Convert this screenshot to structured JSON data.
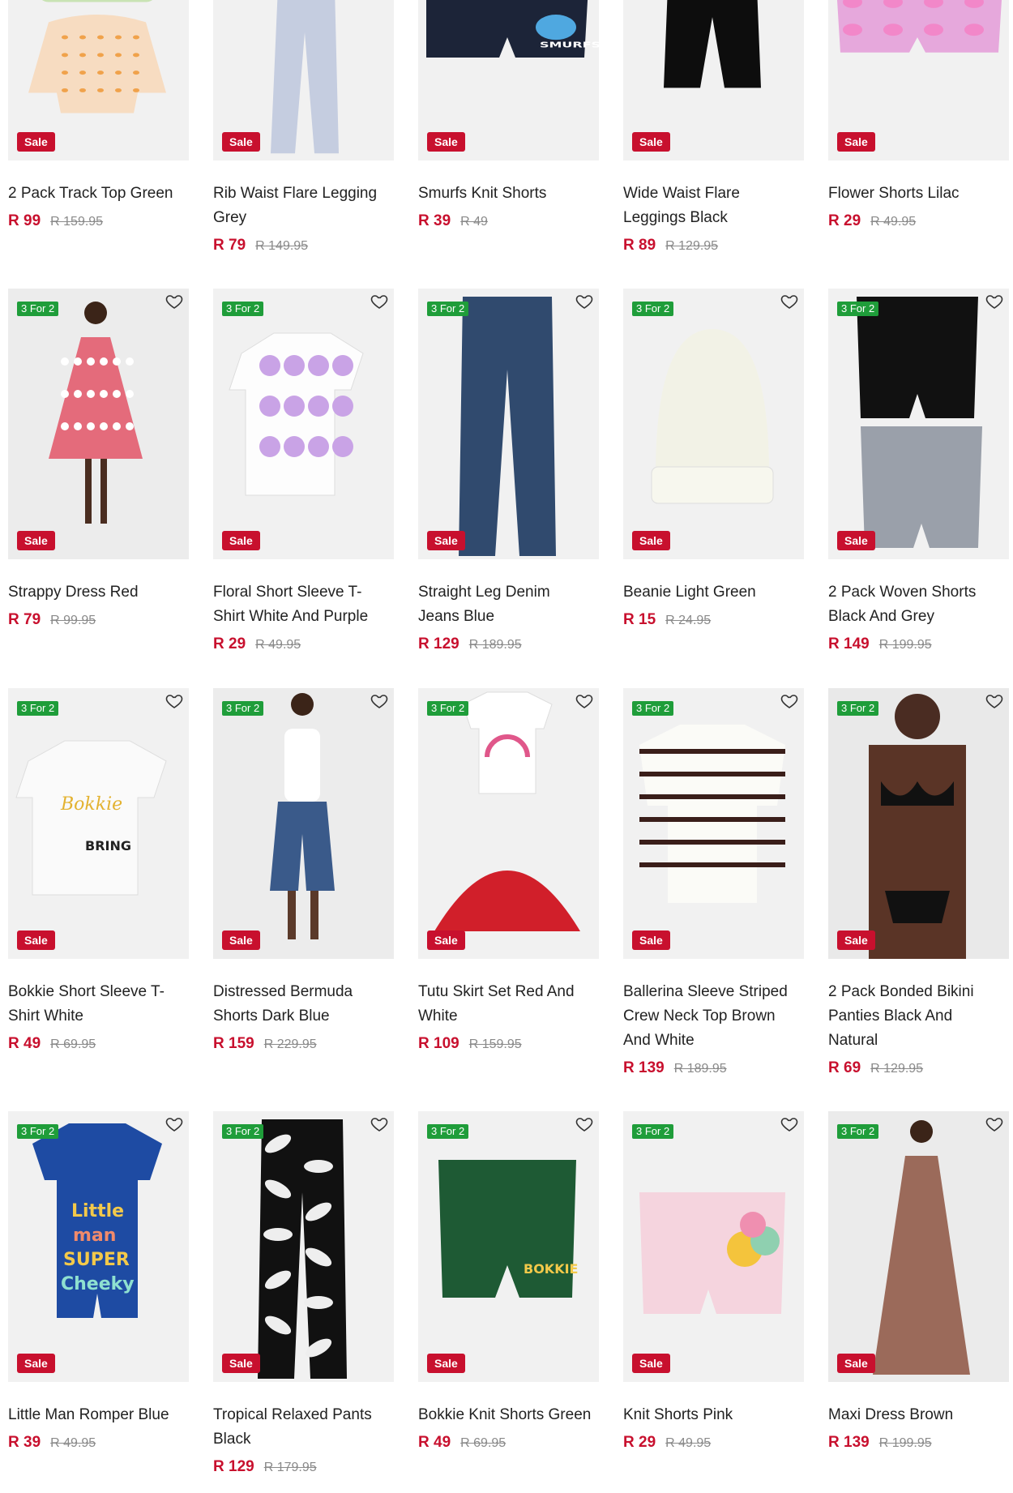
{
  "colors": {
    "sale": "#c8102e",
    "promo": "#1f9d3a",
    "price": "#c8102e",
    "was_price": "#8a8a8a"
  },
  "rows": [
    {
      "products": [
        {
          "name": "2 Pack Track Top Green",
          "price": "R 99",
          "was": "R 159.95",
          "sale_label": "Sale",
          "promo_label": "",
          "art": "hoodie"
        },
        {
          "name": "Rib Waist Flare Legging Grey",
          "price": "R 79",
          "was": "R 149.95",
          "sale_label": "Sale",
          "promo_label": "",
          "art": "legging-grey"
        },
        {
          "name": "Smurfs Knit Shorts",
          "price": "R 39",
          "was": "R 49",
          "sale_label": "Sale",
          "promo_label": "",
          "art": "shorts-navy"
        },
        {
          "name": "Wide Waist Flare Leggings Black",
          "price": "R 89",
          "was": "R 129.95",
          "sale_label": "Sale",
          "promo_label": "",
          "art": "legging-black"
        },
        {
          "name": "Flower Shorts Lilac",
          "price": "R 29",
          "was": "R 49.95",
          "sale_label": "Sale",
          "promo_label": "",
          "art": "shorts-lilac"
        }
      ]
    },
    {
      "products": [
        {
          "name": "Strappy Dress Red",
          "price": "R 79",
          "was": "R 99.95",
          "sale_label": "Sale",
          "promo_label": "3 For 2",
          "art": "dress-red"
        },
        {
          "name": "Floral Short Sleeve T-Shirt White And Purple",
          "price": "R 29",
          "was": "R 49.95",
          "sale_label": "Sale",
          "promo_label": "3 For 2",
          "art": "tee-floral"
        },
        {
          "name": "Straight Leg Denim Jeans Blue",
          "price": "R 129",
          "was": "R 189.95",
          "sale_label": "Sale",
          "promo_label": "3 For 2",
          "art": "jeans"
        },
        {
          "name": "Beanie Light Green",
          "price": "R 15",
          "was": "R 24.95",
          "sale_label": "Sale",
          "promo_label": "3 For 2",
          "art": "beanie"
        },
        {
          "name": "2 Pack Woven Shorts Black And Grey",
          "price": "R 149",
          "was": "R 199.95",
          "sale_label": "Sale",
          "promo_label": "3 For 2",
          "art": "shorts-2pack"
        }
      ]
    },
    {
      "products": [
        {
          "name": "Bokkie Short Sleeve T-Shirt White",
          "price": "R 49",
          "was": "R 69.95",
          "sale_label": "Sale",
          "promo_label": "3 For 2",
          "art": "tee-bokkie"
        },
        {
          "name": "Distressed Bermuda Shorts Dark Blue",
          "price": "R 159",
          "was": "R 229.95",
          "sale_label": "Sale",
          "promo_label": "3 For 2",
          "art": "model-bermuda"
        },
        {
          "name": "Tutu Skirt Set Red And White",
          "price": "R 109",
          "was": "R 159.95",
          "sale_label": "Sale",
          "promo_label": "3 For 2",
          "art": "tutu-set"
        },
        {
          "name": "Ballerina Sleeve Striped Crew Neck Top Brown And White",
          "price": "R 139",
          "was": "R 189.95",
          "sale_label": "Sale",
          "promo_label": "3 For 2",
          "art": "striped-top"
        },
        {
          "name": "2 Pack Bonded Bikini Panties Black And Natural",
          "price": "R 69",
          "was": "R 129.95",
          "sale_label": "Sale",
          "promo_label": "3 For 2",
          "art": "model-lingerie"
        }
      ]
    },
    {
      "products": [
        {
          "name": "Little Man Romper Blue",
          "price": "R 39",
          "was": "R 49.95",
          "sale_label": "Sale",
          "promo_label": "3 For 2",
          "art": "romper"
        },
        {
          "name": "Tropical Relaxed Pants Black",
          "price": "R 129",
          "was": "R 179.95",
          "sale_label": "Sale",
          "promo_label": "3 For 2",
          "art": "pants-tropical"
        },
        {
          "name": "Bokkie Knit Shorts Green",
          "price": "R 49",
          "was": "R 69.95",
          "sale_label": "Sale",
          "promo_label": "3 For 2",
          "art": "shorts-green"
        },
        {
          "name": "Knit Shorts Pink",
          "price": "R 29",
          "was": "R 49.95",
          "sale_label": "Sale",
          "promo_label": "3 For 2",
          "art": "shorts-pink"
        },
        {
          "name": "Maxi Dress Brown",
          "price": "R 139",
          "was": "R 199.95",
          "sale_label": "Sale",
          "promo_label": "3 For 2",
          "art": "model-maxi"
        }
      ]
    }
  ]
}
